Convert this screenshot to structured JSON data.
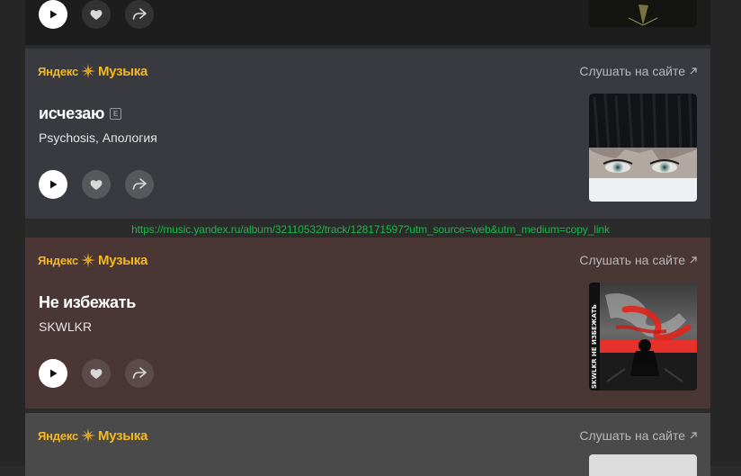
{
  "brand": {
    "part1": "Яндекс",
    "part2": "Музыка"
  },
  "listen_label": "Слушать на сайте",
  "copied_url": "https://music.yandex.ru/album/32110532/track/128171597?utm_source=web&utm_medium=copy_link",
  "tracks": [
    {
      "title": "исчезаю",
      "explicit": "E",
      "artist": "Psychosis, Апология"
    },
    {
      "title": "Не избежать",
      "artist": "SKWLKR"
    }
  ],
  "cover_texts": {
    "track_2_spine": "SKWLKR НЕ ИЗБЕЖАТЬ"
  },
  "icons": {
    "play": "play-icon",
    "like": "heart-icon",
    "share": "share-icon",
    "external": "external-link-icon",
    "logo": "sunburst-logo-icon"
  },
  "colors": {
    "brand_yellow": "#f5b820",
    "link_green": "#19b84a",
    "card_1_bg": "#383a3f",
    "card_2_bg": "#4a3634",
    "card_3_bg": "#4a4a4a"
  }
}
